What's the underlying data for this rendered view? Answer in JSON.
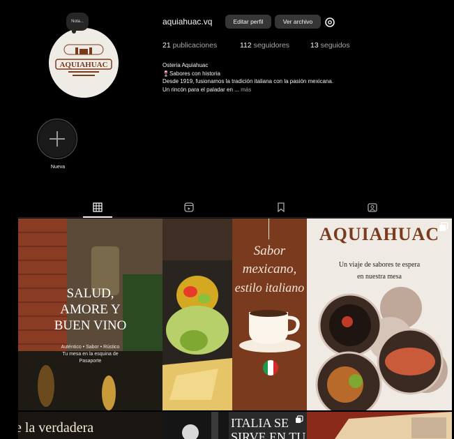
{
  "profile": {
    "username": "aquiahuac.vq",
    "note": "Nota...",
    "avatar_logo_text": "AQUIAHUAC",
    "edit_label": "Editar perfil",
    "archive_label": "Ver archivo",
    "stats": {
      "posts_count": "21",
      "posts_label": "publicaciones",
      "followers_count": "112",
      "followers_label": "seguidores",
      "following_count": "13",
      "following_label": "seguidos"
    },
    "bio": {
      "name": "Osteria Aquiahuac",
      "line1": "🍷Sabores con historia",
      "line2": "Desde 1919, fusionamos la tradición italiana con la pasión mexicana.",
      "line3": "Un rincón para el paladar en ...",
      "more": "más"
    }
  },
  "highlight": {
    "label": "Nueva",
    "icon": "plus-icon"
  },
  "tabs": [
    {
      "icon": "grid-icon",
      "active": true
    },
    {
      "icon": "reels-icon",
      "active": false
    },
    {
      "icon": "bookmark-icon",
      "active": false
    },
    {
      "icon": "tagged-icon",
      "active": false
    }
  ],
  "posts": [
    {
      "line1": "SALUD,",
      "line2": "AMORE Y",
      "line3": "BUEN VINO",
      "sub1": "Auténtico • Sabor • Rústico",
      "sub2": "Tu mesa en la esquina de",
      "sub3": "Pasaporte"
    },
    {
      "image": "food-photo"
    },
    {
      "line1": "Sabor",
      "line2": "mexicano,",
      "line3": "estilo italiano"
    },
    {
      "title": "AQUIAHUAC",
      "line1": "Un viaje de sabores te espera",
      "line2": "en nuestra mesa"
    },
    {
      "text": "e la verdadera"
    },
    {
      "image": "wine-photo"
    },
    {
      "line1": "ITALIA SE",
      "line2": "SIRVE EN TU"
    },
    {
      "image": "pizza-photo"
    }
  ],
  "colors": {
    "background": "#000000",
    "button": "#363636",
    "muted": "#a8a8a8",
    "brown": "#7a3a1e",
    "cream": "#efece6"
  }
}
